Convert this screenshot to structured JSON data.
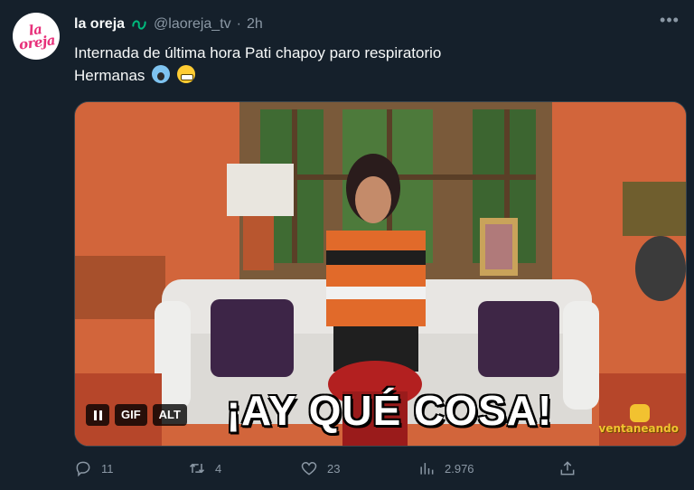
{
  "tweet": {
    "display_name": "la oreja",
    "handle": "@laoreja_tv",
    "separator": "·",
    "time": "2h",
    "avatar_text": "la oreja",
    "text_line1": "Internada de última hora Pati chapoy paro respiratorio",
    "text_line2": "Hermanas",
    "emojis": [
      "screaming-face",
      "grimacing-face"
    ],
    "more_icon": "more-horizontal-icon"
  },
  "media": {
    "caption": "¡AY QUÉ COSA!",
    "watermark": "ventaneando",
    "controls": {
      "pause_label": "pause",
      "gif_label": "GIF",
      "alt_label": "ALT"
    }
  },
  "actions": {
    "replies": "11",
    "retweets": "4",
    "likes": "23",
    "views": "2.976"
  },
  "colors": {
    "background": "#15202b",
    "text": "#f7f9f9",
    "muted": "#8b98a5",
    "verified": "#00ba7c"
  }
}
